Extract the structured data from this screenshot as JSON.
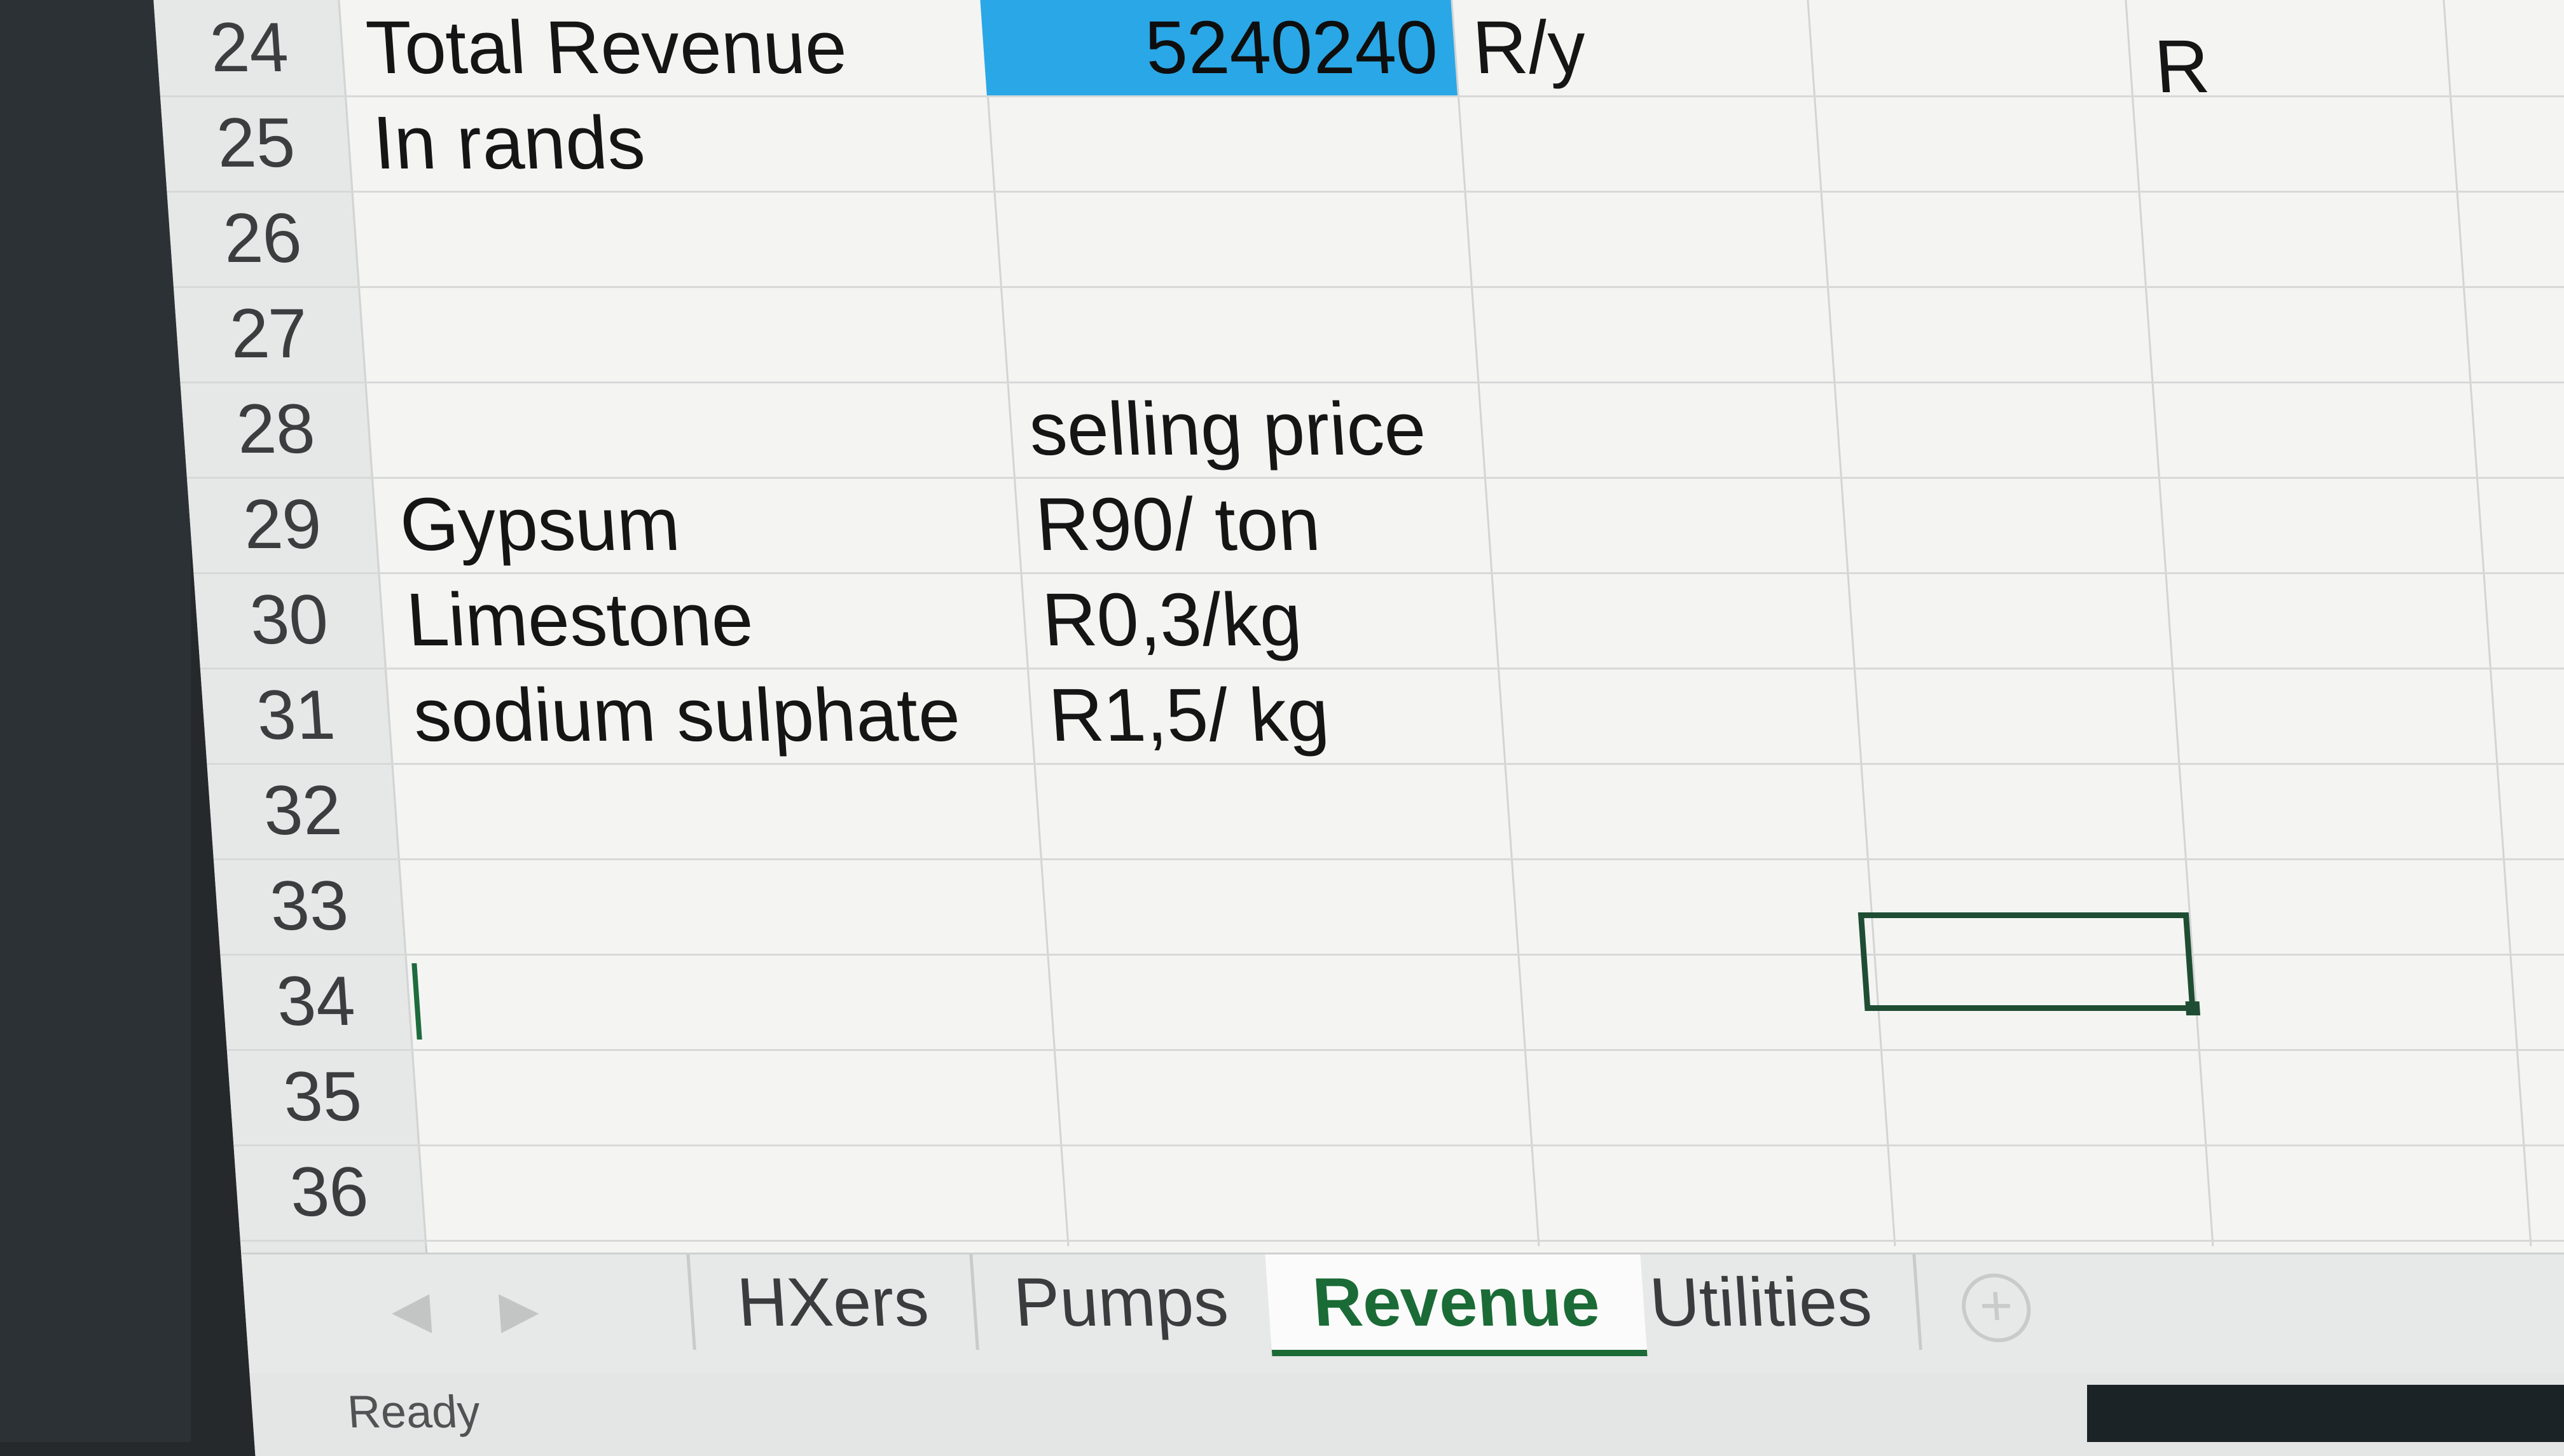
{
  "rows": [
    {
      "num": "24",
      "a": "Total Revenue",
      "b": "5240240",
      "c": "R/y",
      "e": "R"
    },
    {
      "num": "25",
      "a": "In rands",
      "b": "",
      "c": "",
      "e": ""
    },
    {
      "num": "26",
      "a": "",
      "b": "",
      "c": "",
      "e": ""
    },
    {
      "num": "27",
      "a": "",
      "b": "",
      "c": "",
      "e": ""
    },
    {
      "num": "28",
      "a": "",
      "b": "selling price",
      "c": "",
      "e": ""
    },
    {
      "num": "29",
      "a": "Gypsum",
      "b": "R90/ ton",
      "c": "",
      "e": ""
    },
    {
      "num": "30",
      "a": "Limestone",
      "b": "R0,3/kg",
      "c": "",
      "e": ""
    },
    {
      "num": "31",
      "a": "sodium sulphate",
      "b": "R1,5/ kg",
      "c": "",
      "e": ""
    },
    {
      "num": "32",
      "a": "",
      "b": "",
      "c": "",
      "e": ""
    },
    {
      "num": "33",
      "a": "",
      "b": "",
      "c": "",
      "e": ""
    },
    {
      "num": "34",
      "a": "",
      "b": "",
      "c": "",
      "e": ""
    },
    {
      "num": "35",
      "a": "",
      "b": "",
      "c": "",
      "e": ""
    },
    {
      "num": "36",
      "a": "",
      "b": "",
      "c": "",
      "e": ""
    }
  ],
  "tabs": [
    "HXers",
    "Pumps",
    "Revenue",
    "Utilities"
  ],
  "active_tab": "Revenue",
  "add_tab_symbol": "+",
  "nav_prev": "◀",
  "nav_next": "▶",
  "status": "Ready",
  "colors": {
    "highlight": "#2aa7e6",
    "accent": "#1b6b37"
  }
}
